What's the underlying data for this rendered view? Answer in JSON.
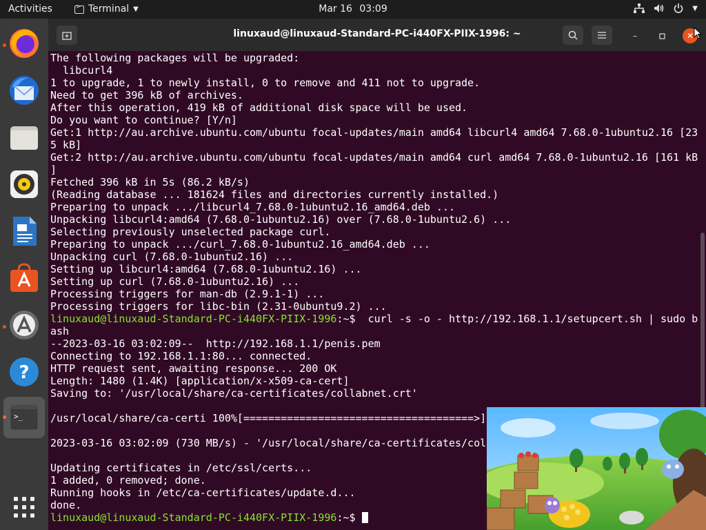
{
  "topbar": {
    "activities": "Activities",
    "app_name": "Terminal",
    "date": "Mar 16",
    "time": "03:09"
  },
  "dock": {
    "items": [
      "Firefox",
      "Thunderbird",
      "Files",
      "Rhythmbox",
      "LibreOffice Writer",
      "Ubuntu Software",
      "Software Updater",
      "Help",
      "Terminal",
      "Show Applications"
    ]
  },
  "window": {
    "title": "linuxaud@linuxaud-Standard-PC-i440FX-PIIX-1996: ~"
  },
  "terminal": {
    "prompt": "linuxaud@linuxaud-Standard-PC-i440FX-PIIX-1996",
    "lines": [
      "The following packages will be upgraded:",
      "  libcurl4",
      "1 to upgrade, 1 to newly install, 0 to remove and 411 not to upgrade.",
      "Need to get 396 kB of archives.",
      "After this operation, 419 kB of additional disk space will be used.",
      "Do you want to continue? [Y/n]",
      "Get:1 http://au.archive.ubuntu.com/ubuntu focal-updates/main amd64 libcurl4 amd64 7.68.0-1ubuntu2.16 [23",
      "5 kB]",
      "Get:2 http://au.archive.ubuntu.com/ubuntu focal-updates/main amd64 curl amd64 7.68.0-1ubuntu2.16 [161 kB",
      "]",
      "Fetched 396 kB in 5s (86.2 kB/s)",
      "(Reading database ... 181624 files and directories currently installed.)",
      "Preparing to unpack .../libcurl4_7.68.0-1ubuntu2.16_amd64.deb ...",
      "Unpacking libcurl4:amd64 (7.68.0-1ubuntu2.16) over (7.68.0-1ubuntu2.6) ...",
      "Selecting previously unselected package curl.",
      "Preparing to unpack .../curl_7.68.0-1ubuntu2.16_amd64.deb ...",
      "Unpacking curl (7.68.0-1ubuntu2.16) ...",
      "Setting up libcurl4:amd64 (7.68.0-1ubuntu2.16) ...",
      "Setting up curl (7.68.0-1ubuntu2.16) ...",
      "Processing triggers for man-db (2.9.1-1) ...",
      "Processing triggers for libc-bin (2.31-0ubuntu9.2) ..."
    ],
    "command_line": {
      "prompt_suffix": ":~$ ",
      "command": " curl -s -o - http://192.168.1.1/setupcert.sh | sudo b",
      "wrap": "ash"
    },
    "lines2": [
      "--2023-03-16 03:02:09--  http://192.168.1.1/penis.pem",
      "Connecting to 192.168.1.1:80... connected.",
      "HTTP request sent, awaiting response... 200 OK",
      "Length: 1480 (1.4K) [application/x-x509-ca-cert]",
      "Saving to: '/usr/local/share/ca-certificates/collabnet.crt'",
      "",
      "/usr/local/share/ca-certi 100%[=====================================>]",
      "",
      "2023-03-16 03:02:09 (730 MB/s) - '/usr/local/share/ca-certificates/col",
      "",
      "Updating certificates in /etc/ssl/certs...",
      "1 added, 0 removed; done.",
      "Running hooks in /etc/ca-certificates/update.d...",
      "done."
    ],
    "final_prompt_suffix": ":~$ "
  }
}
